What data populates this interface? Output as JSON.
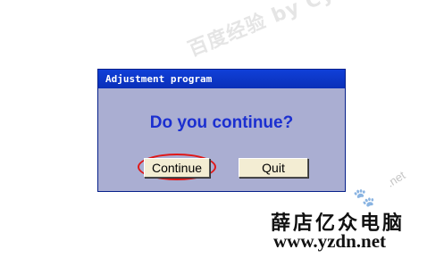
{
  "watermarks": {
    "top": "百度经验 by Cynthia",
    "net": ".net",
    "brand": "薛店亿众电脑",
    "url": "www.yzdn.net"
  },
  "dialog": {
    "title": "Adjustment program",
    "prompt": "Do you continue?",
    "continue_label": "Continue",
    "quit_label": "Quit"
  },
  "colors": {
    "titlebar": "#0a2fb8",
    "dialog_bg": "#aaaed2",
    "prompt_text": "#1b2fd0",
    "button_bg": "#f3edd3",
    "highlight": "#e01818"
  },
  "icons": {
    "paw": "paw-icon"
  }
}
